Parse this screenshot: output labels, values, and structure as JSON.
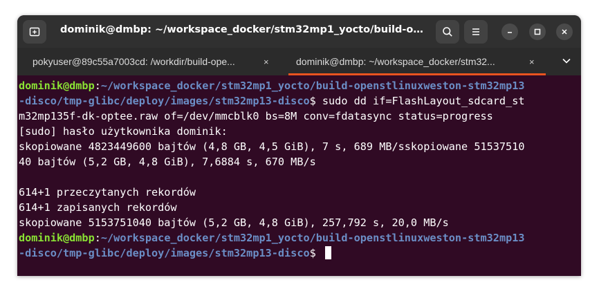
{
  "window": {
    "title": "dominik@dmbp: ~/workspace_docker/stm32mp1_yocto/build-openstlinux..."
  },
  "tabs": [
    {
      "label": "pokyuser@89c55a7003cd: /workdir/build-ope...",
      "active": false
    },
    {
      "label": "dominik@dmbp: ~/workspace_docker/stm32...",
      "active": true
    }
  ],
  "icons": {
    "new_tab": "new-tab-icon",
    "search": "search-icon",
    "menu": "hamburger-icon",
    "minimize": "minimize-icon",
    "maximize": "maximize-icon",
    "close": "close-icon",
    "tab_close": "×",
    "tab_overflow": "chevron-down-icon"
  },
  "colors": {
    "terminal_bg": "#300a24",
    "prompt_user": "#8ae234",
    "prompt_path": "#6b8ec6",
    "accent": "#e95420"
  },
  "terminal": {
    "line1_user": "dominik@dmbp",
    "line1_sep": ":",
    "line1_path": "~/workspace_docker/stm32mp1_yocto/build-openstlinuxweston-stm32mp13",
    "line2_path": "-disco/tmp-glibc/deploy/images/stm32mp13-disco",
    "line2_cmd": "$ sudo dd if=FlashLayout_sdcard_st",
    "line3": "m32mp135f-dk-optee.raw of=/dev/mmcblk0 bs=8M conv=fdatasync status=progress",
    "line4": "[sudo] hasło użytkownika dominik:",
    "line5": "skopiowane 4823449600 bajtów (4,8 GB, 4,5 GiB), 7 s, 689 MB/sskopiowane 51537510",
    "line6": "40 bajtów (5,2 GB, 4,8 GiB), 7,6884 s, 670 MB/s",
    "line7": "",
    "line8": "614+1 przeczytanych rekordów",
    "line9": "614+1 zapisanych rekordów",
    "line10": "skopiowane 5153751040 bajtów (5,2 GB, 4,8 GiB), 257,792 s, 20,0 MB/s",
    "line11_user": "dominik@dmbp",
    "line11_sep": ":",
    "line11_path": "~/workspace_docker/stm32mp1_yocto/build-openstlinuxweston-stm32mp13",
    "line12_path": "-disco/tmp-glibc/deploy/images/stm32mp13-disco",
    "line12_cmd": "$ "
  }
}
